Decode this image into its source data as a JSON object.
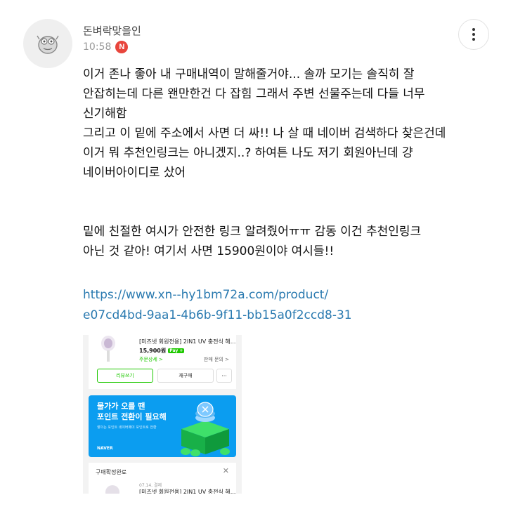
{
  "comment": {
    "author": "돈벼락맞을인",
    "time": "10:58",
    "new_badge": "N",
    "more_icon": "vertical-ellipsis-icon",
    "avatar_icon": "character-avatar-icon",
    "body_lines_1": [
      "이거 존나 좋아 내 구매내역이 말해줄거야... 솔까 모기는 솔직히 잘",
      "안잡히는데 다른 왠만한건 다 잡힘 그래서 주변 선물주는데 다들 너무",
      "신기해함",
      "그리고 이 밑에 주소에서 사면 더 싸!! 나 살 때 네이버 검색하다 찾은건데",
      "이거 뭐 추천인링크는 아니겠지..? 하여튼 나도 저기 회원아닌데 걍",
      "네이버아이디로 샀어"
    ],
    "body_lines_2": [
      "밑에 친절한 여시가 안전한 링크 알려줬어ㅠㅠ 감동 이건 추천인링크",
      "아닌 것 같아! 여기서 사면 15900원이야 여시들!!"
    ],
    "link_lines": [
      "https://www.xn--hy1bm72a.com/product/",
      "e07cd4bd-9aa1-4b6b-9f11-bb15a0f2ccd8-31"
    ],
    "link_color": "#2a7ab0"
  },
  "attachment": {
    "product_name": "[미즈넷 회원전용] 2IN1 UV 충전식 해...",
    "price": "15,900원",
    "pay_badge": "Pay +",
    "order_detail": "주문상세 >",
    "seller_inquiry": "판매 문의 >",
    "review_button": "리뷰쓰기",
    "rebuy_button": "재구매",
    "more_button": "···",
    "banner_title": "물가가 오를 땐",
    "banner_subtitle": "포인트 전환이 필요해",
    "banner_desc": "쌓이는 포인트 네이버페이 포인트로 전환",
    "banner_brand": "NAVER",
    "banner_color": "#0b9df0",
    "section_title": "구매확정완료",
    "close_icon": "close-icon",
    "second_date": "07.14. 결제",
    "second_name": "[미즈넷 회원전용] 2IN1 UV 충전식 해..."
  }
}
